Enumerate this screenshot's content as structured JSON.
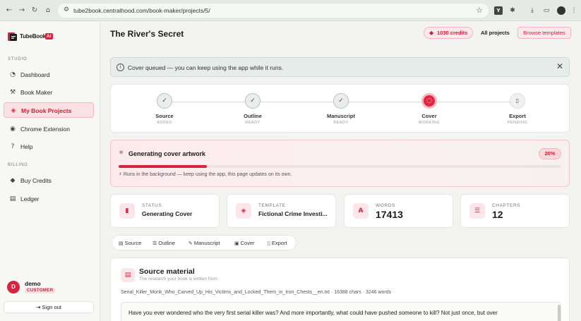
{
  "browser": {
    "url": "tube2book.centralhood.com/book-maker/projects/5/"
  },
  "sidebar": {
    "logo_text": "TubeBook",
    "logo_ai": "AI",
    "section_studio": "STUDIO",
    "section_billing": "BILLING",
    "studio_items": [
      {
        "label": "Dashboard",
        "icon": "speedometer-icon"
      },
      {
        "label": "Book Maker",
        "icon": "wand-icon"
      },
      {
        "label": "My Book Projects",
        "icon": "layers-icon"
      },
      {
        "label": "Chrome Extension",
        "icon": "chrome-icon"
      },
      {
        "label": "Help",
        "icon": "help-icon"
      }
    ],
    "billing_items": [
      {
        "label": "Buy Credits",
        "icon": "gem-icon"
      },
      {
        "label": "Ledger",
        "icon": "ledger-icon"
      }
    ],
    "user": {
      "initial": "D",
      "name": "demo",
      "role": "CUSTOMER"
    },
    "signout_label": "Sign out"
  },
  "header": {
    "title": "The River's Secret",
    "credits": "1030 credits",
    "all_projects": "All projects",
    "browse_templates": "Browse templates"
  },
  "toast": {
    "message": "Cover queued — you can keep using the app while it runs."
  },
  "steps": [
    {
      "name": "Source",
      "status": "ADDED",
      "state": "done"
    },
    {
      "name": "Outline",
      "status": "READY",
      "state": "done"
    },
    {
      "name": "Manuscript",
      "status": "READY",
      "state": "done"
    },
    {
      "name": "Cover",
      "status": "WORKING",
      "state": "working"
    },
    {
      "name": "Export",
      "status": "PENDING",
      "state": "pending"
    }
  ],
  "generation": {
    "title": "Generating cover artwork",
    "progress_pct": 20,
    "progress_label": "20%",
    "note": "Runs in the background — keep using the app, this page updates on its own."
  },
  "stats": [
    {
      "label": "STATUS",
      "value": "Generating Cover",
      "icon": "signal-icon"
    },
    {
      "label": "TEMPLATE",
      "value": "Fictional Crime Investi...",
      "icon": "layers-icon"
    },
    {
      "label": "WORDS",
      "value": "17413",
      "icon": "letter-a-icon"
    },
    {
      "label": "CHAPTERS",
      "value": "12",
      "icon": "list-icon"
    }
  ],
  "tabs": [
    "Source",
    "Outline",
    "Manuscript",
    "Cover",
    "Export"
  ],
  "source": {
    "title": "Source material",
    "subtitle": "The research your book is written from",
    "file_meta": "Serial_Killer_Monk_Who_Carved_Up_His_Victims_and_Locked_Them_in_Iron_Chests__en.txt · 16388 chars · 3246 words",
    "text": "Have you ever wondered who the very first serial killer was? And more importantly, what could have pushed someone to kill? Not just once, but over"
  },
  "colors": {
    "accent": "#d6243f",
    "accent_light": "#fde6e9"
  }
}
